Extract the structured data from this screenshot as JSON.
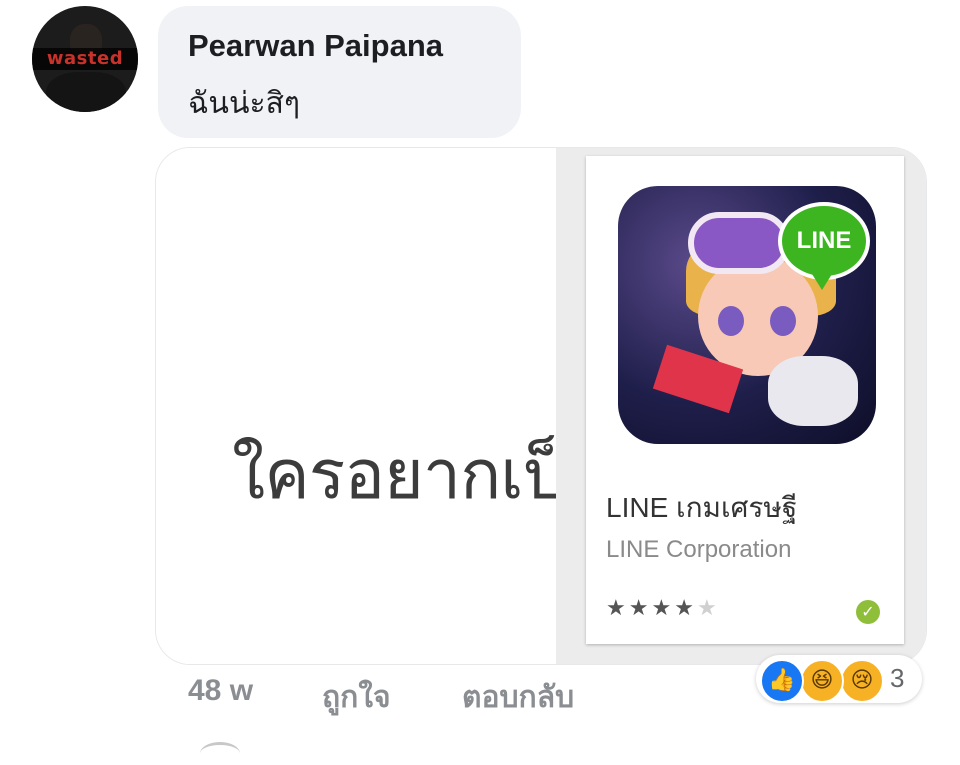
{
  "comment": {
    "avatar_caption": "wasted",
    "author": "Pearwan Paipana",
    "text": "ฉันน่ะสิๆ"
  },
  "attachment": {
    "big_text": "ใครอยากเป็น",
    "app_card": {
      "badge_text": "LINE",
      "app_name": "LINE เกมเศรษฐี",
      "publisher": "LINE Corporation",
      "rating_stars": 4,
      "rating_max": 5,
      "verified_icon": "check-circle-icon"
    }
  },
  "footer": {
    "time": "48 w",
    "like": "ถูกใจ",
    "reply": "ตอบกลับ"
  },
  "reactions": {
    "icons": [
      "like-icon",
      "haha-icon",
      "sad-icon"
    ],
    "count": "3"
  },
  "colors": {
    "bubble_bg": "#f0f2f5",
    "meta_text": "#8a8d91",
    "like_blue": "#1877f2",
    "line_green": "#3cb521"
  }
}
